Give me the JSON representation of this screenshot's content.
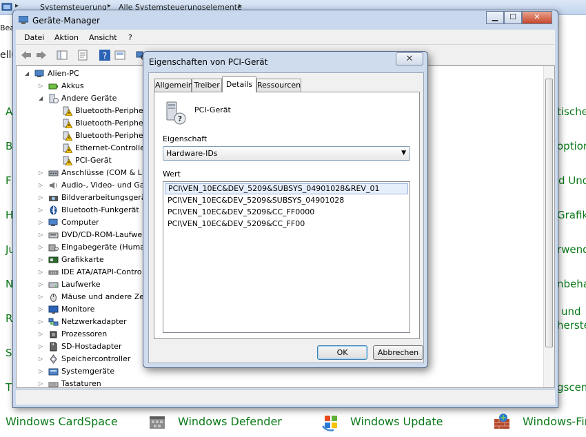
{
  "background": {
    "breadcrumb": [
      "Systemsteuerung",
      "Alle Systemsteuerungselemente"
    ],
    "left_strip_text": "Bea",
    "left_header_text": "ellu",
    "left_letters": [
      "A",
      "B",
      "F",
      "H",
      "Ju",
      "N",
      "R",
      "S",
      "T"
    ],
    "right_fragments": [
      "tische",
      "optior",
      "d Und",
      "Grafik",
      "rwendu",
      "nbeha",
      "und",
      "herste",
      "gscen"
    ],
    "bottom_items": [
      "Windows CardSpace",
      "Windows Defender",
      "Windows Update",
      "Windows-Fire"
    ],
    "accent_color": "#0b7a1a"
  },
  "device_manager": {
    "title": "Geräte-Manager",
    "menu": [
      "Datei",
      "Aktion",
      "Ansicht",
      "?"
    ],
    "window_buttons": {
      "minimize": "▁",
      "maximize": "☐",
      "close": "✕"
    },
    "tree": [
      {
        "label": "Alien-PC",
        "depth": 0,
        "arrow": "◢",
        "icon": "computer-icon"
      },
      {
        "label": "Akkus",
        "depth": 1,
        "arrow": "▷",
        "icon": "battery-icon"
      },
      {
        "label": "Andere Geräte",
        "depth": 1,
        "arrow": "◢",
        "icon": "unknown-device-icon"
      },
      {
        "label": "Bluetooth-Peripher",
        "depth": 2,
        "arrow": "",
        "icon": "warning-device-icon"
      },
      {
        "label": "Bluetooth-Peripher",
        "depth": 2,
        "arrow": "",
        "icon": "warning-device-icon"
      },
      {
        "label": "Bluetooth-Peripher",
        "depth": 2,
        "arrow": "",
        "icon": "warning-device-icon"
      },
      {
        "label": "Ethernet-Controlle",
        "depth": 2,
        "arrow": "",
        "icon": "warning-device-icon"
      },
      {
        "label": "PCI-Gerät",
        "depth": 2,
        "arrow": "",
        "icon": "warning-device-icon"
      },
      {
        "label": "Anschlüsse (COM & LI",
        "depth": 1,
        "arrow": "▷",
        "icon": "port-icon"
      },
      {
        "label": "Audio-, Video- und Ga",
        "depth": 1,
        "arrow": "▷",
        "icon": "speaker-icon"
      },
      {
        "label": "Bildverarbeitungsgerät",
        "depth": 1,
        "arrow": "▷",
        "icon": "camera-icon"
      },
      {
        "label": "Bluetooth-Funkgerät",
        "depth": 1,
        "arrow": "▷",
        "icon": "bluetooth-icon"
      },
      {
        "label": "Computer",
        "depth": 1,
        "arrow": "▷",
        "icon": "computer-icon"
      },
      {
        "label": "DVD/CD-ROM-Laufwe",
        "depth": 1,
        "arrow": "▷",
        "icon": "disc-drive-icon"
      },
      {
        "label": "Eingabegeräte (Humar",
        "depth": 1,
        "arrow": "▷",
        "icon": "input-device-icon"
      },
      {
        "label": "Grafikkarte",
        "depth": 1,
        "arrow": "▷",
        "icon": "display-adapter-icon"
      },
      {
        "label": "IDE ATA/ATAPI-Contro",
        "depth": 1,
        "arrow": "▷",
        "icon": "ide-icon"
      },
      {
        "label": "Laufwerke",
        "depth": 1,
        "arrow": "▷",
        "icon": "drive-icon"
      },
      {
        "label": "Mäuse und andere Zei",
        "depth": 1,
        "arrow": "▷",
        "icon": "mouse-icon"
      },
      {
        "label": "Monitore",
        "depth": 1,
        "arrow": "▷",
        "icon": "monitor-icon"
      },
      {
        "label": "Netzwerkadapter",
        "depth": 1,
        "arrow": "▷",
        "icon": "network-icon"
      },
      {
        "label": "Prozessoren",
        "depth": 1,
        "arrow": "▷",
        "icon": "processor-icon"
      },
      {
        "label": "SD-Hostadapter",
        "depth": 1,
        "arrow": "▷",
        "icon": "sd-icon"
      },
      {
        "label": "Speichercontroller",
        "depth": 1,
        "arrow": "▷",
        "icon": "storage-icon"
      },
      {
        "label": "Systemgeräte",
        "depth": 1,
        "arrow": "▷",
        "icon": "system-icon"
      },
      {
        "label": "Tastaturen",
        "depth": 1,
        "arrow": "▷",
        "icon": "keyboard-icon"
      }
    ]
  },
  "dialog": {
    "title": "Eigenschaften von PCI-Gerät",
    "close_glyph": "✕",
    "tabs": [
      "Allgemein",
      "Treiber",
      "Details",
      "Ressourcen"
    ],
    "active_tab": "Details",
    "device_name": "PCI-Gerät",
    "property_label": "Eigenschaft",
    "property_value": "Hardware-IDs",
    "dropdown_glyph": "▼",
    "value_label": "Wert",
    "values": [
      "PCI\\VEN_10EC&DEV_5209&SUBSYS_04901028&REV_01",
      "PCI\\VEN_10EC&DEV_5209&SUBSYS_04901028",
      "PCI\\VEN_10EC&DEV_5209&CC_FF0000",
      "PCI\\VEN_10EC&DEV_5209&CC_FF00"
    ],
    "ok_label": "OK",
    "cancel_label": "Abbrechen"
  }
}
